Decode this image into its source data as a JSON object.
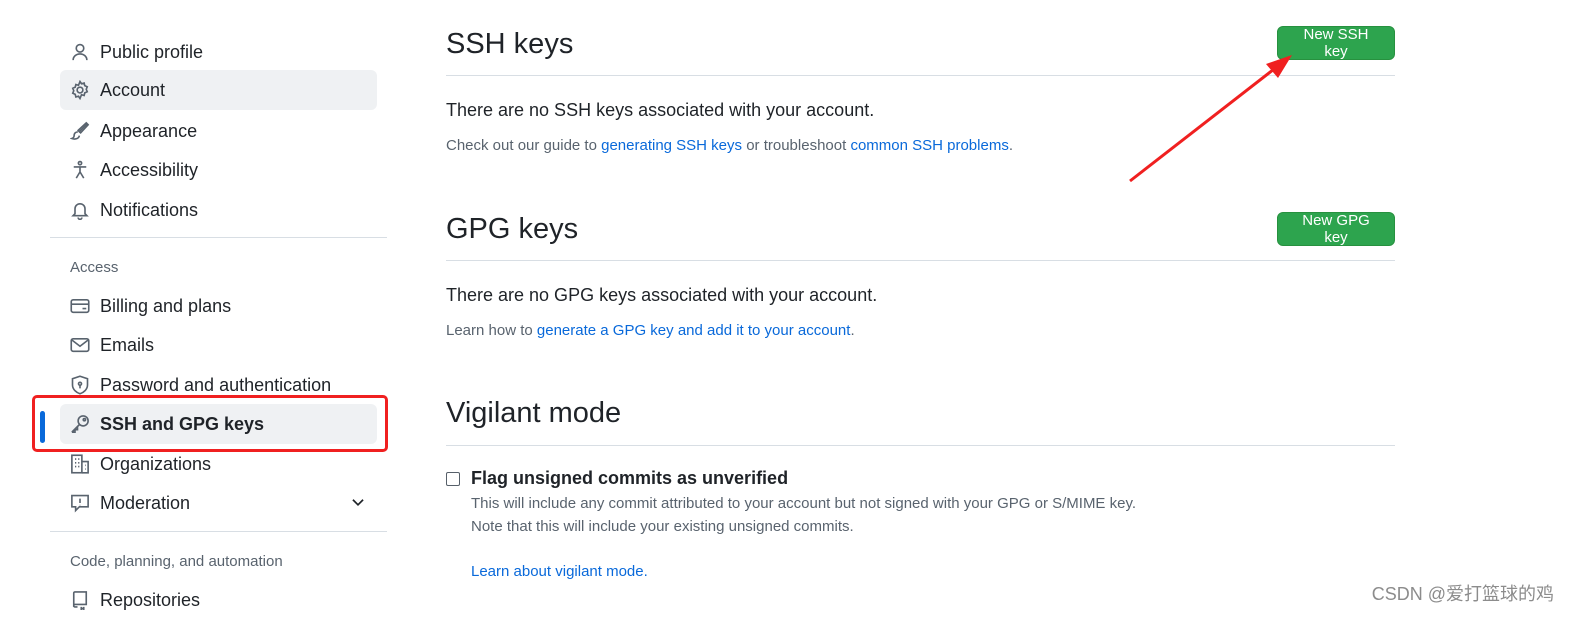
{
  "sidebar": {
    "items_top": [
      {
        "label": "Public profile",
        "icon": "person-icon"
      },
      {
        "label": "Account",
        "icon": "gear-icon",
        "active": true
      },
      {
        "label": "Appearance",
        "icon": "paintbrush-icon"
      },
      {
        "label": "Accessibility",
        "icon": "accessibility-icon"
      },
      {
        "label": "Notifications",
        "icon": "bell-icon"
      }
    ],
    "access_label": "Access",
    "items_access": [
      {
        "label": "Billing and plans",
        "icon": "credit-card-icon"
      },
      {
        "label": "Emails",
        "icon": "mail-icon"
      },
      {
        "label": "Password and authentication",
        "icon": "shield-lock-icon"
      },
      {
        "label": "SSH and GPG keys",
        "icon": "key-icon",
        "active": true
      },
      {
        "label": "Organizations",
        "icon": "organization-icon"
      },
      {
        "label": "Moderation",
        "icon": "report-icon"
      }
    ],
    "code_label": "Code, planning, and automation",
    "items_code": [
      {
        "label": "Repositories",
        "icon": "repo-icon"
      }
    ]
  },
  "ssh": {
    "title": "SSH keys",
    "button": "New SSH key",
    "empty": "There are no SSH keys associated with your account.",
    "note_prefix": "Check out our guide to ",
    "note_link1": "generating SSH keys",
    "note_middle": " or troubleshoot ",
    "note_link2": "common SSH problems",
    "note_suffix": "."
  },
  "gpg": {
    "title": "GPG keys",
    "button": "New GPG key",
    "empty": "There are no GPG keys associated with your account.",
    "note_prefix": "Learn how to ",
    "note_link": "generate a GPG key and add it to your account",
    "note_suffix": "."
  },
  "vigilant": {
    "title": "Vigilant mode",
    "checkbox_label": "Flag unsigned commits as unverified",
    "desc1": "This will include any commit attributed to your account but not signed with your GPG or S/MIME key.",
    "desc2": "Note that this will include your existing unsigned commits.",
    "learn_link": "Learn about vigilant mode",
    "learn_suffix": "."
  },
  "watermark": "CSDN @爱打篮球的鸡",
  "colors": {
    "accent_blue": "#0969da",
    "button_green": "#2da44e",
    "annotation_red": "#f02020"
  }
}
